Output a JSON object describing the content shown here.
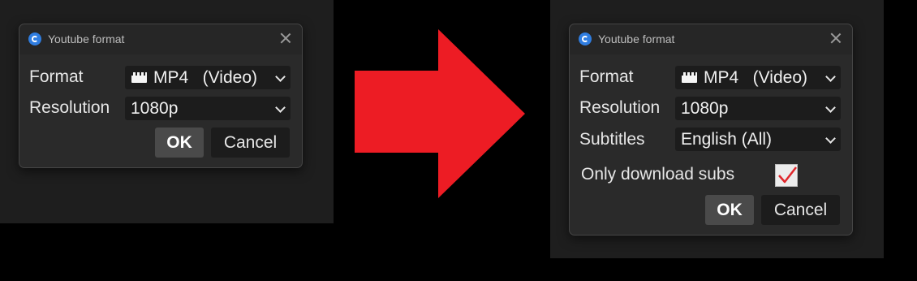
{
  "before": {
    "dialog": {
      "title": "Youtube format",
      "format_label": "Format",
      "format_value": "MP4   (Video)",
      "resolution_label": "Resolution",
      "resolution_value": "1080p",
      "ok_label": "OK",
      "cancel_label": "Cancel"
    }
  },
  "after": {
    "dialog": {
      "title": "Youtube format",
      "format_label": "Format",
      "format_value": "MP4   (Video)",
      "resolution_label": "Resolution",
      "resolution_value": "1080p",
      "subtitles_label": "Subtitles",
      "subtitles_value": "English (All)",
      "only_subs_label": "Only download subs",
      "only_subs_checked": true,
      "ok_label": "OK",
      "cancel_label": "Cancel"
    }
  },
  "icons": {
    "app": "app-logo-icon",
    "close": "close-icon",
    "dropdown": "chevron-down-icon",
    "format": "film-clapper-icon",
    "checkbox": "check-icon",
    "transition": "right-arrow-icon"
  },
  "colors": {
    "arrow": "#ed1c24",
    "check": "#e0262b",
    "app_icon": "#2f7de0",
    "dialog_bg": "#2a2a2a",
    "ok_button_bg": "#4a4a4a"
  }
}
